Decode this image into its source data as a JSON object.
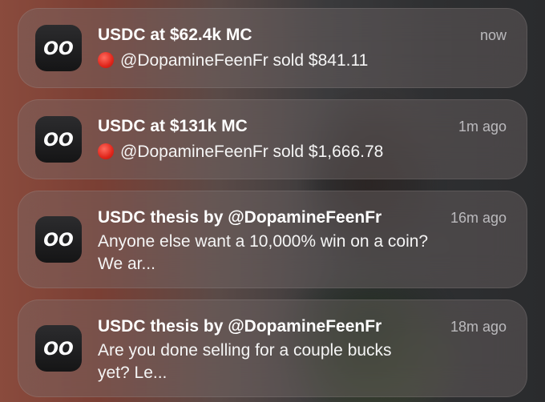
{
  "notifications": [
    {
      "title": "USDC at $62.4k MC",
      "time": "now",
      "body": "@DopamineFeenFr sold $841.11",
      "has_red_dot": true
    },
    {
      "title": "USDC at $131k MC",
      "time": "1m ago",
      "body": "@DopamineFeenFr sold $1,666.78",
      "has_red_dot": true
    },
    {
      "title": "USDC thesis by @DopamineFeenFr",
      "time": "16m ago",
      "body_line1": "Anyone else want a 10,000% win on a coin?",
      "body_line2": "We ar...",
      "has_red_dot": false
    },
    {
      "title": "USDC thesis by @DopamineFeenFr",
      "time": "18m ago",
      "body_line1": "Are you done selling for a couple bucks",
      "body_line2": "yet? Le...",
      "has_red_dot": false
    }
  ],
  "app_icon": "app-logo-icon",
  "colors": {
    "red_dot": "#e0261b",
    "card": "#786e6e"
  }
}
